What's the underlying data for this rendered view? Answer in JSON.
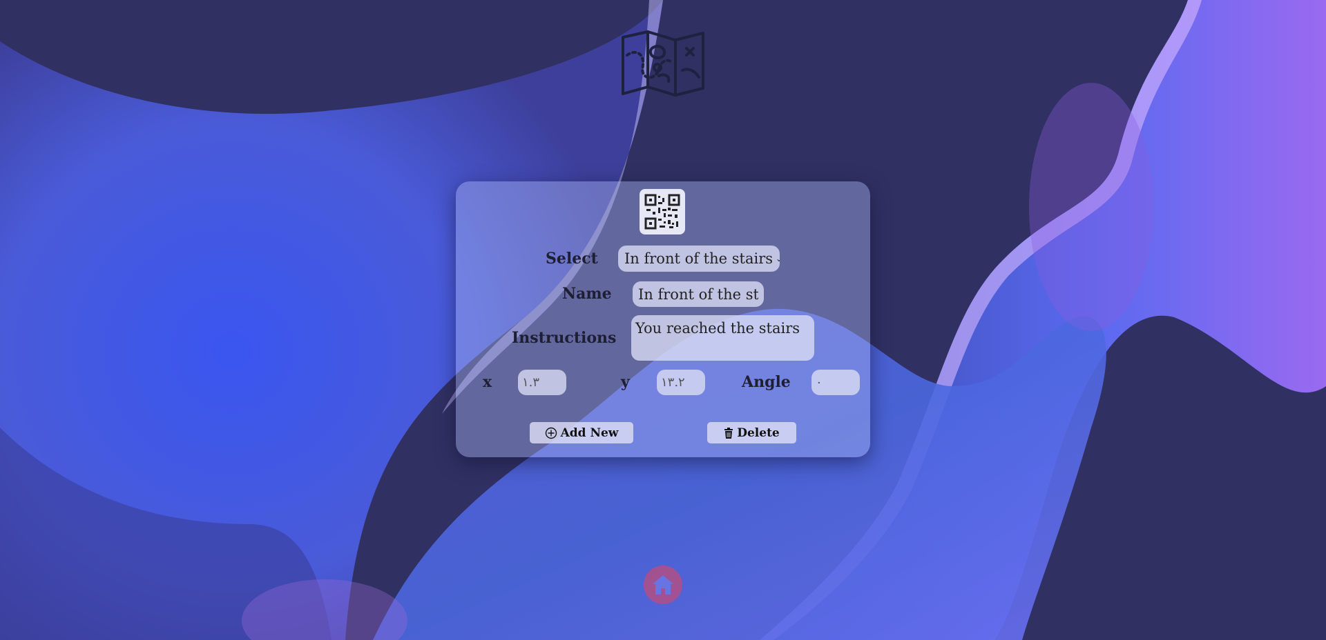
{
  "form": {
    "select_label": "Select",
    "select_value": "In front of the stairs",
    "name_label": "Name",
    "name_value": "In front of the stai",
    "instructions_label": "Instructions",
    "instructions_value": "You reached the stairs",
    "x_label": "x",
    "x_value": "١.٣",
    "y_label": "y",
    "y_value": "١٣.٢",
    "angle_label": "Angle",
    "angle_value": "٠"
  },
  "buttons": {
    "add_label": "Add New",
    "delete_label": "Delete"
  },
  "icons": {
    "logo": "treasure-map-icon",
    "qr": "qr-code-icon",
    "add": "plus-circle-icon",
    "delete": "trash-icon",
    "home": "home-icon"
  },
  "colors": {
    "background": "#303062",
    "accent_blue": "#3a56f0",
    "accent_purple": "#8a5be0",
    "home_button": "#b14e86"
  }
}
